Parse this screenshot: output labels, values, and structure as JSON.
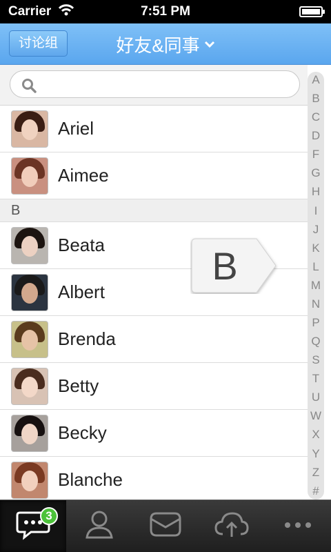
{
  "status_bar": {
    "carrier": "Carrier",
    "time": "7:51 PM"
  },
  "nav": {
    "group_button_label": "讨论组",
    "title": "好友&同事"
  },
  "search": {
    "placeholder": ""
  },
  "contacts_a": [
    {
      "name": "Ariel"
    },
    {
      "name": "Aimee"
    }
  ],
  "section_b": {
    "header": "B"
  },
  "contacts_b": [
    {
      "name": "Beata"
    },
    {
      "name": "Albert"
    },
    {
      "name": "Brenda"
    },
    {
      "name": "Betty"
    },
    {
      "name": "Becky"
    },
    {
      "name": "Blanche"
    }
  ],
  "index_letters": [
    "A",
    "B",
    "C",
    "D",
    "F",
    "G",
    "H",
    "I",
    "J",
    "K",
    "L",
    "M",
    "N",
    "P",
    "Q",
    "S",
    "T",
    "U",
    "W",
    "X",
    "Y",
    "Z",
    "#"
  ],
  "popup": {
    "letter": "B"
  },
  "tab_bar": {
    "tabs": [
      {
        "icon": "chat-bubble-icon",
        "badge": "3"
      },
      {
        "icon": "contacts-icon"
      },
      {
        "icon": "mail-icon"
      },
      {
        "icon": "cloud-upload-icon"
      },
      {
        "icon": "more-icon"
      }
    ]
  },
  "colors": {
    "nav_blue": "#5aa6ee",
    "badge_green": "#4cc23a",
    "tab_bar_dark": "#1f1f1f"
  }
}
